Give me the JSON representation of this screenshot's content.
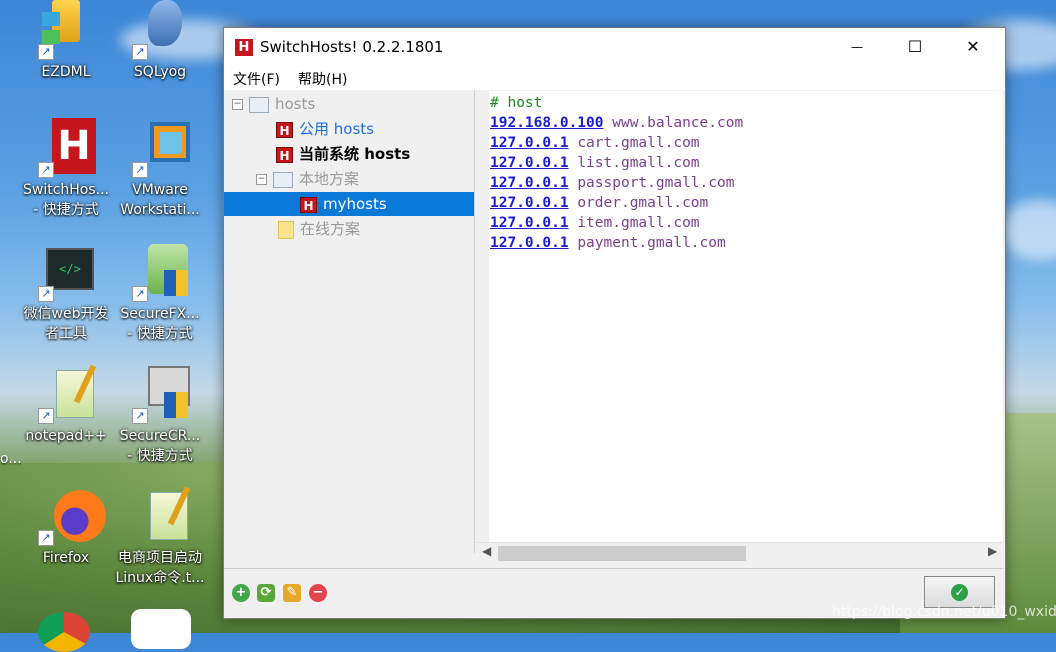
{
  "desktop": {
    "icons": [
      {
        "label1": "EZDML",
        "label2": ""
      },
      {
        "label1": "SQLyog",
        "label2": ""
      },
      {
        "label1": "SwitchHos...",
        "label2": "- 快捷方式"
      },
      {
        "label1": "VMware",
        "label2": "Workstati..."
      },
      {
        "label1": "微信web开发",
        "label2": "者工具"
      },
      {
        "label1": "SecureFX...",
        "label2": "- 快捷方式"
      },
      {
        "label1": "notepad++",
        "label2": ""
      },
      {
        "label1": "SecureCR...",
        "label2": "- 快捷方式"
      },
      {
        "label1": "Firefox",
        "label2": ""
      },
      {
        "label1": "电商项目启动",
        "label2": "Linux命令.t..."
      }
    ],
    "edge_text": "o..."
  },
  "window": {
    "title": "SwitchHosts! 0.2.2.1801",
    "app_icon_letter": "H",
    "minimize_glyph": "—",
    "maximize_glyph": "☐",
    "close_glyph": "✕"
  },
  "menu": {
    "file": "文件(F)",
    "help": "帮助(H)"
  },
  "tree": {
    "root": "hosts",
    "public": "公用 hosts",
    "current": "当前系统 hosts",
    "local": "本地方案",
    "myhosts": "myhosts",
    "online": "在线方案"
  },
  "editor": {
    "comment": "# host",
    "lines": [
      {
        "ip": "192.168.0.100",
        "domain": "www.balance.com"
      },
      {
        "ip": "127.0.0.1",
        "domain": "cart.gmall.com"
      },
      {
        "ip": "127.0.0.1",
        "domain": "list.gmall.com"
      },
      {
        "ip": "127.0.0.1",
        "domain": "passport.gmall.com"
      },
      {
        "ip": "127.0.0.1",
        "domain": "order.gmall.com"
      },
      {
        "ip": "127.0.0.1",
        "domain": "item.gmall.com"
      },
      {
        "ip": "127.0.0.1",
        "domain": "payment.gmall.com"
      }
    ]
  },
  "watermark": "https://blog.csdn.net/u010_wxid",
  "colors": {
    "accent_selection": "#0a78d7",
    "ip_blue": "#1b1bd0",
    "domain_purple": "#7a3f8d",
    "comment_green": "#1a8a1a",
    "brand_red": "#c4161c"
  }
}
